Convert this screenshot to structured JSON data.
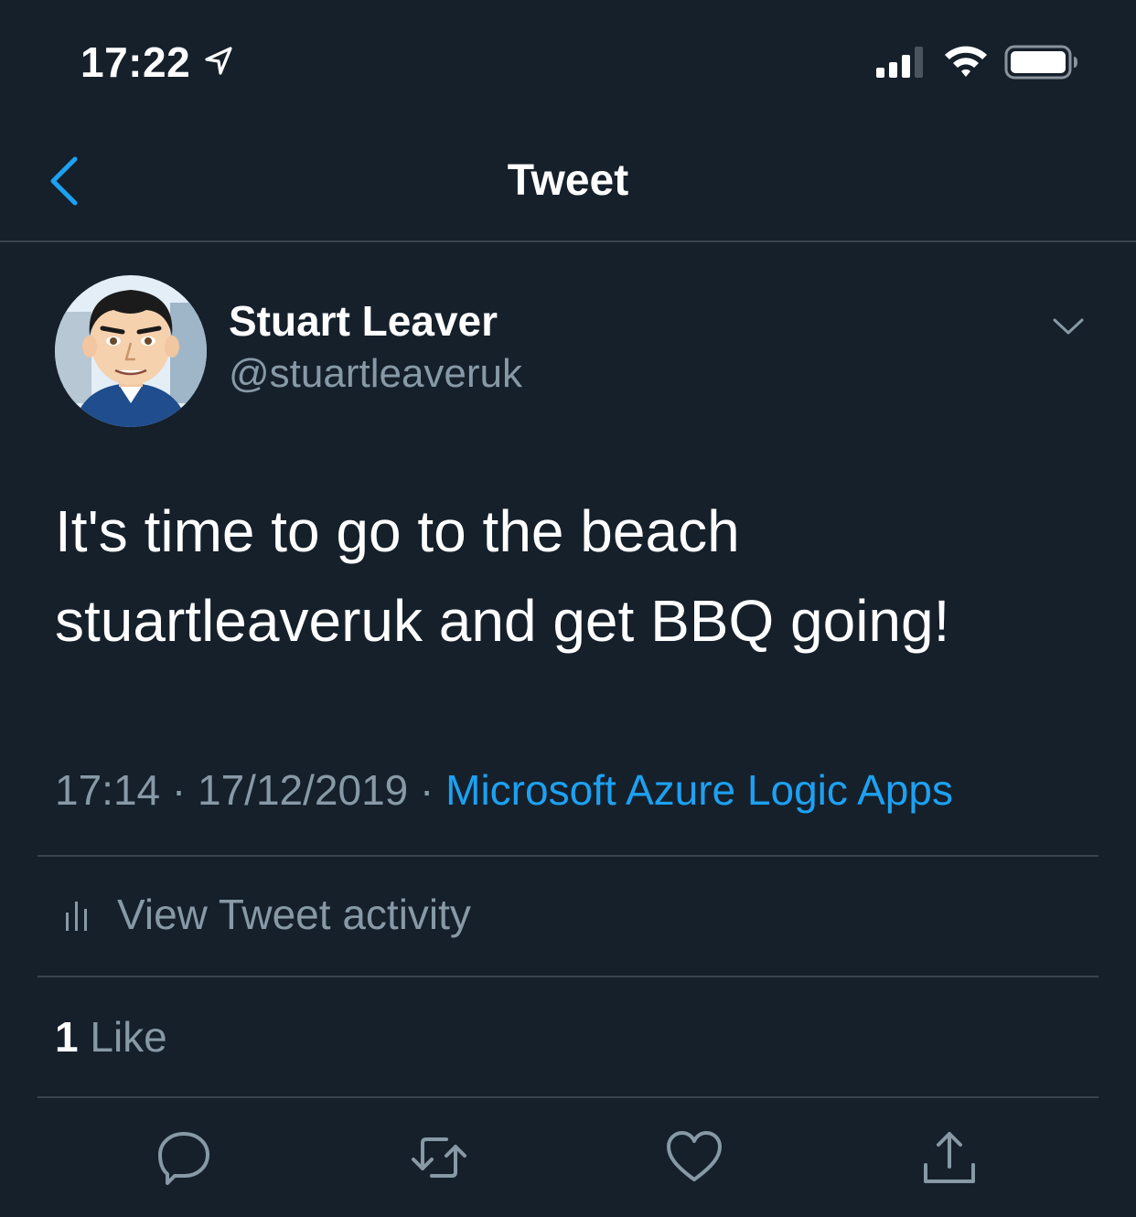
{
  "status_bar": {
    "time": "17:22",
    "icons": [
      "location-arrow-icon",
      "cellular-signal-icon",
      "wifi-icon",
      "battery-icon"
    ]
  },
  "nav": {
    "title": "Tweet",
    "back_icon": "chevron-left-icon"
  },
  "tweet": {
    "author": {
      "name": "Stuart Leaver",
      "handle": "@stuartleaveruk"
    },
    "text_line_1": "It's time to go to the beach",
    "text_line_2": "stuartleaveruk and get BBQ going!",
    "time": "17:14",
    "separator": "·",
    "date": "17/12/2019",
    "source": "Microsoft Azure Logic Apps",
    "activity_label": "View Tweet activity",
    "likes_count": "1",
    "likes_label": "Like",
    "actions": [
      "reply-icon",
      "retweet-icon",
      "like-icon",
      "share-icon"
    ]
  },
  "colors": {
    "background": "#15202b",
    "divider": "#38444d",
    "secondary_text": "#8899a6",
    "accent": "#1da1f2"
  }
}
